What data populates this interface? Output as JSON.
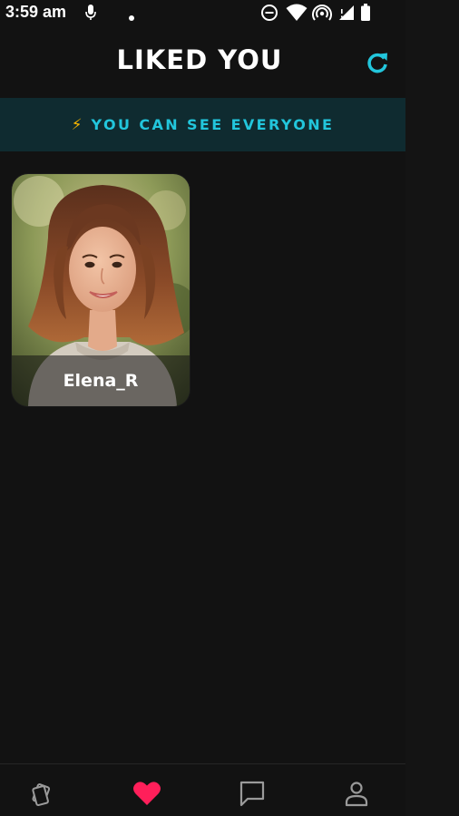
{
  "status_bar": {
    "time": "3:59 am"
  },
  "header": {
    "title": "LIKED YOU",
    "refresh_icon": "refresh-icon"
  },
  "banner": {
    "icon": "lightning-icon",
    "text": "YOU CAN SEE EVERYONE"
  },
  "profiles": [
    {
      "name": "Elena_R"
    }
  ],
  "bottom_nav": {
    "items": [
      {
        "icon": "cards-icon",
        "active": false
      },
      {
        "icon": "heart-icon",
        "active": true
      },
      {
        "icon": "chat-icon",
        "active": false
      },
      {
        "icon": "profile-icon",
        "active": false
      }
    ]
  },
  "colors": {
    "background": "#121212",
    "accent": "#22c6dc",
    "banner_bg": "#0f2b30",
    "active_heart": "#ff1f5a",
    "lightning": "#f5b400"
  }
}
